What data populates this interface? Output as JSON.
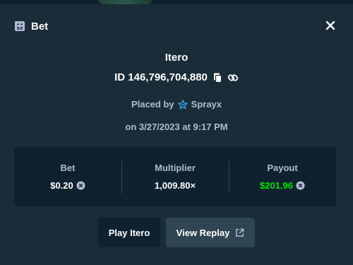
{
  "modal": {
    "title": "Bet",
    "header_icon": "bet-slip-icon",
    "close_icon": "close-icon"
  },
  "bet": {
    "game": "Itero",
    "id_text": "ID 146,796,704,880",
    "placed_by_label": "Placed by",
    "user": "Sprayx",
    "date_text": "on 3/27/2023 at 9:17 PM"
  },
  "stats": {
    "bet_label": "Bet",
    "bet_value": "$0.20",
    "multiplier_label": "Multiplier",
    "multiplier_value": "1,009.80×",
    "payout_label": "Payout",
    "payout_value": "$201.96"
  },
  "actions": {
    "play_label": "Play Itero",
    "replay_label": "View Replay"
  },
  "colors": {
    "background": "#1a2c38",
    "panel": "#0f212e",
    "secondary_button": "#2f4553",
    "payout_green": "#00e701",
    "muted_text": "#b1bad3",
    "user_badge": "#2f9bd6"
  }
}
